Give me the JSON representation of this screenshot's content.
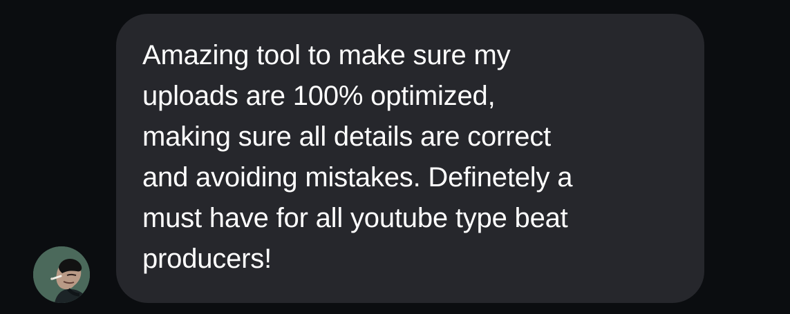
{
  "conversation": {
    "message": {
      "text": "Amazing tool to make sure my\nuploads are 100% optimized,\nmaking sure all details are correct\nand avoiding mistakes. Definetely a\nmust have for all youtube type beat\nproducers!"
    },
    "avatar": {
      "icon": "profile-photo-avatar",
      "colors": {
        "background": "#3d5a4f",
        "hair": "#121212",
        "skin": "#b99a86",
        "shirt": "#1c2427"
      }
    },
    "bubble": {
      "background_color": "#26272c",
      "text_color": "#ffffff"
    }
  }
}
